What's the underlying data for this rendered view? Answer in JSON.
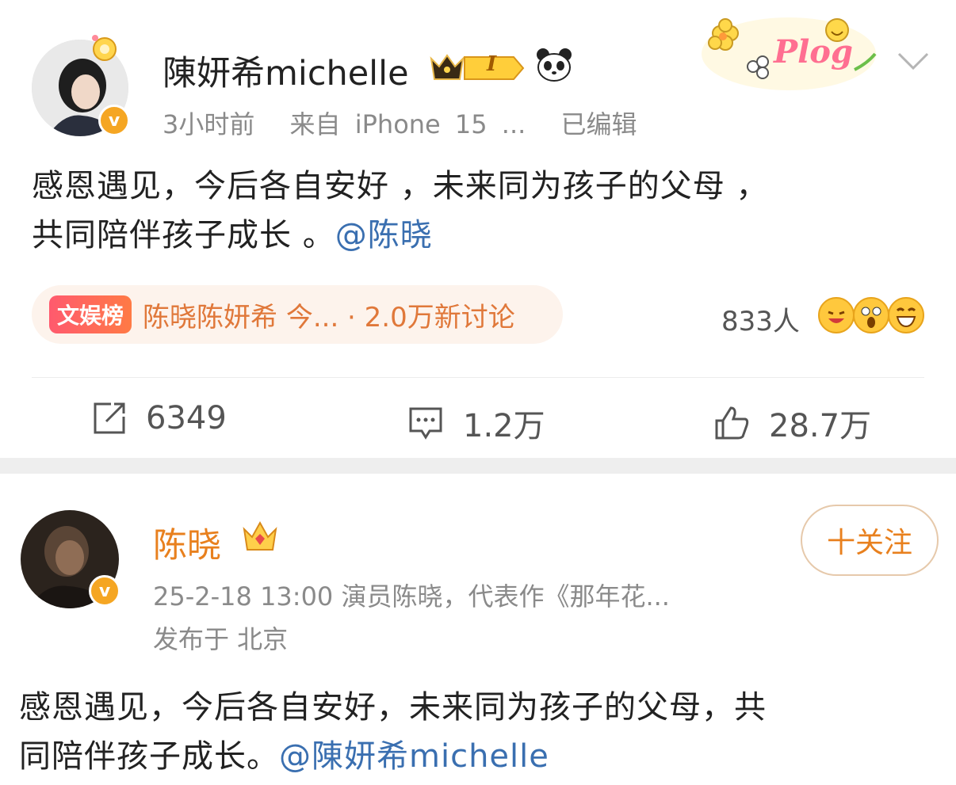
{
  "post1": {
    "username": "陳妍希michelle",
    "level_badge": "I",
    "meta_time": "3小时前",
    "meta_source": "来自 iPhone 15 ...",
    "meta_edited": "已编辑",
    "text_line1": "感恩遇见，今后各自安好 ，未来同为孩子的父母 ，",
    "text_line2": "共同陪伴孩子成长 。",
    "mention": "@陈晓",
    "topic_tag": "文娱榜",
    "topic_text": "陈晓陈妍希 今... · 2.0万新讨论",
    "people_count": "833人",
    "repost_count": "6349",
    "comment_count": "1.2万",
    "like_count": "28.7万",
    "sticker_text": "Plog"
  },
  "post2": {
    "username": "陈晓",
    "follow_label": "十关注",
    "meta_line1": "25-2-18 13:00  演员陈晓，代表作《那年花...",
    "meta_line2": "发布于 北京",
    "text_line1": "感恩遇见，今后各自安好，未来同为孩子的父母，共",
    "text_line2": "同陪伴孩子成长。",
    "mention": "@陳妍希michelle"
  },
  "icons": {
    "verified": "v",
    "colors": {
      "orange": "#f5a623",
      "link": "#3a6fb0",
      "topic": "#e0783a"
    }
  }
}
